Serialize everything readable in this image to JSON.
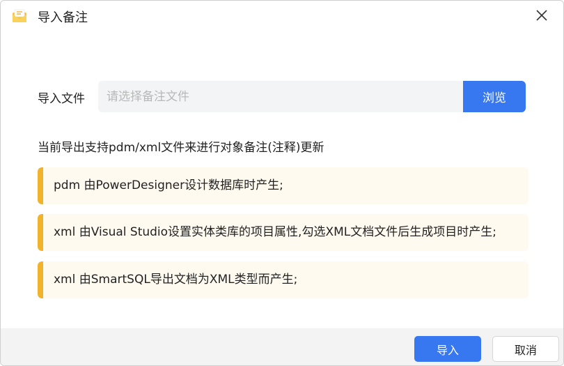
{
  "window": {
    "title": "导入备注",
    "icon": "envelope-note-icon",
    "close_icon": "close-icon"
  },
  "form": {
    "import_label": "导入文件",
    "file_placeholder": "请选择备注文件",
    "file_value": "",
    "browse_label": "浏览"
  },
  "description": "当前导出支持pdm/xml文件来进行对象备注(注释)更新",
  "notes": [
    {
      "text": "pdm 由PowerDesigner设计数据库时产生;"
    },
    {
      "text": "xml 由Visual Studio设置实体类库的项目属性,勾选XML文档文件后生成项目时产生;"
    },
    {
      "text": "xml 由SmartSQL导出文档为XML类型而产生;"
    }
  ],
  "footer": {
    "ok_label": "导入",
    "cancel_label": "取消"
  },
  "colors": {
    "primary": "#3777f0",
    "note_accent": "#f2b32c",
    "note_bg": "#fffaf0",
    "input_bg": "#f3f4f6"
  }
}
